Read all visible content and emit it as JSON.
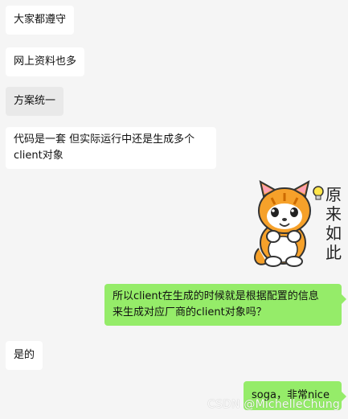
{
  "messages": [
    {
      "side": "left",
      "text": "大家都遵守"
    },
    {
      "side": "left",
      "text": "网上资料也多"
    },
    {
      "side": "left",
      "text": "方案统一"
    },
    {
      "side": "left",
      "line1": "代码是一套 但实际运行中还是生成多个",
      "line2": "client对象"
    },
    {
      "side": "right",
      "type": "sticker",
      "sticker_text": [
        "原",
        "来",
        "如",
        "此"
      ]
    },
    {
      "side": "right",
      "line1": "所以client在生成的时候就是根据配置的信息",
      "line2": "来生成对应厂商的client对象吗？"
    },
    {
      "side": "left",
      "text": "是的"
    },
    {
      "side": "right",
      "text": "soga，非常nice"
    }
  ],
  "watermark": "CSDN @MichelleChung",
  "colors": {
    "background": "#f5f5f5",
    "left_bubble": "#ffffff",
    "left_bubble_selected": "#e9e9e9",
    "right_bubble": "#95ec69"
  }
}
